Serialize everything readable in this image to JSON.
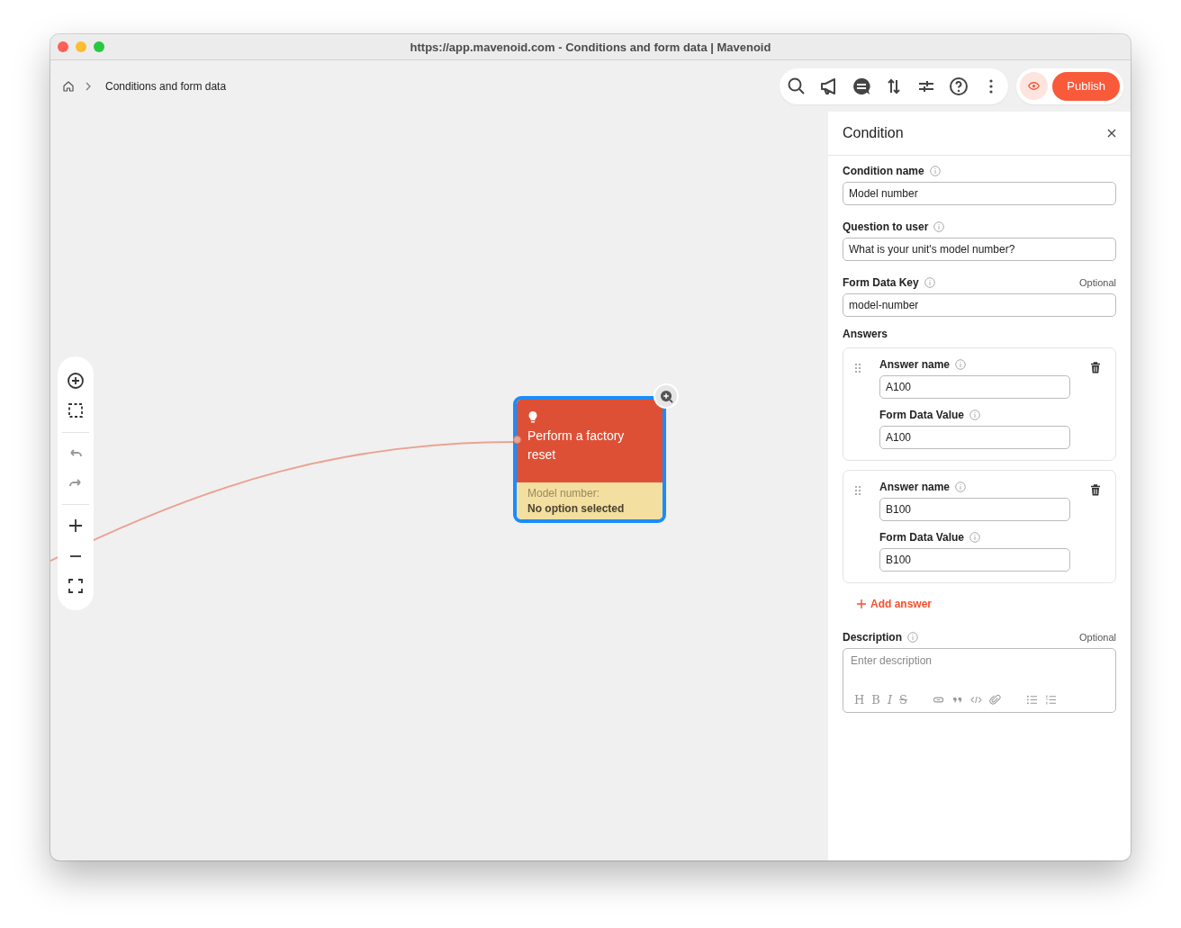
{
  "window": {
    "title": "https://app.mavenoid.com - Conditions and form data | Mavenoid"
  },
  "breadcrumb": {
    "current": "Conditions and form data"
  },
  "publish": {
    "label": "Publish",
    "preview_on": true
  },
  "zoom_controls": [
    {
      "kind": "add",
      "disabled": false
    },
    {
      "kind": "select",
      "disabled": false
    },
    {
      "kind": "undo",
      "disabled": true
    },
    {
      "kind": "redo",
      "disabled": true
    },
    {
      "kind": "zoom-in",
      "disabled": false
    },
    {
      "kind": "zoom-out",
      "disabled": false
    },
    {
      "kind": "fit",
      "disabled": false
    }
  ],
  "node": {
    "label": "Perform a factory reset",
    "condition_label": "Model number:",
    "condition_value": "No option selected",
    "selected": true
  },
  "panel": {
    "title": "Condition",
    "fields": [
      {
        "label": "Condition name",
        "value": "Model number"
      },
      {
        "label": "Question to user",
        "value": "What is your unit's model number?"
      },
      {
        "label": "Form Data Key",
        "value": "model-number",
        "note": "Optional"
      }
    ],
    "answers_heading": "Answers",
    "answers": [
      {
        "name_label": "Answer name",
        "name": "A100",
        "value_label": "Form Data Value",
        "value": "A100"
      },
      {
        "name_label": "Answer name",
        "name": "B100",
        "value_label": "Form Data Value",
        "value": "B100"
      }
    ],
    "add_answer": "Add answer",
    "description": {
      "label": "Description",
      "note": "Optional",
      "placeholder": "Enter description",
      "format_buttons": [
        {
          "kind": "heading",
          "glyph": "H"
        },
        {
          "kind": "bold",
          "glyph": "B"
        },
        {
          "kind": "italic",
          "glyph": "I"
        },
        {
          "kind": "strike",
          "glyph": "S"
        }
      ]
    }
  }
}
